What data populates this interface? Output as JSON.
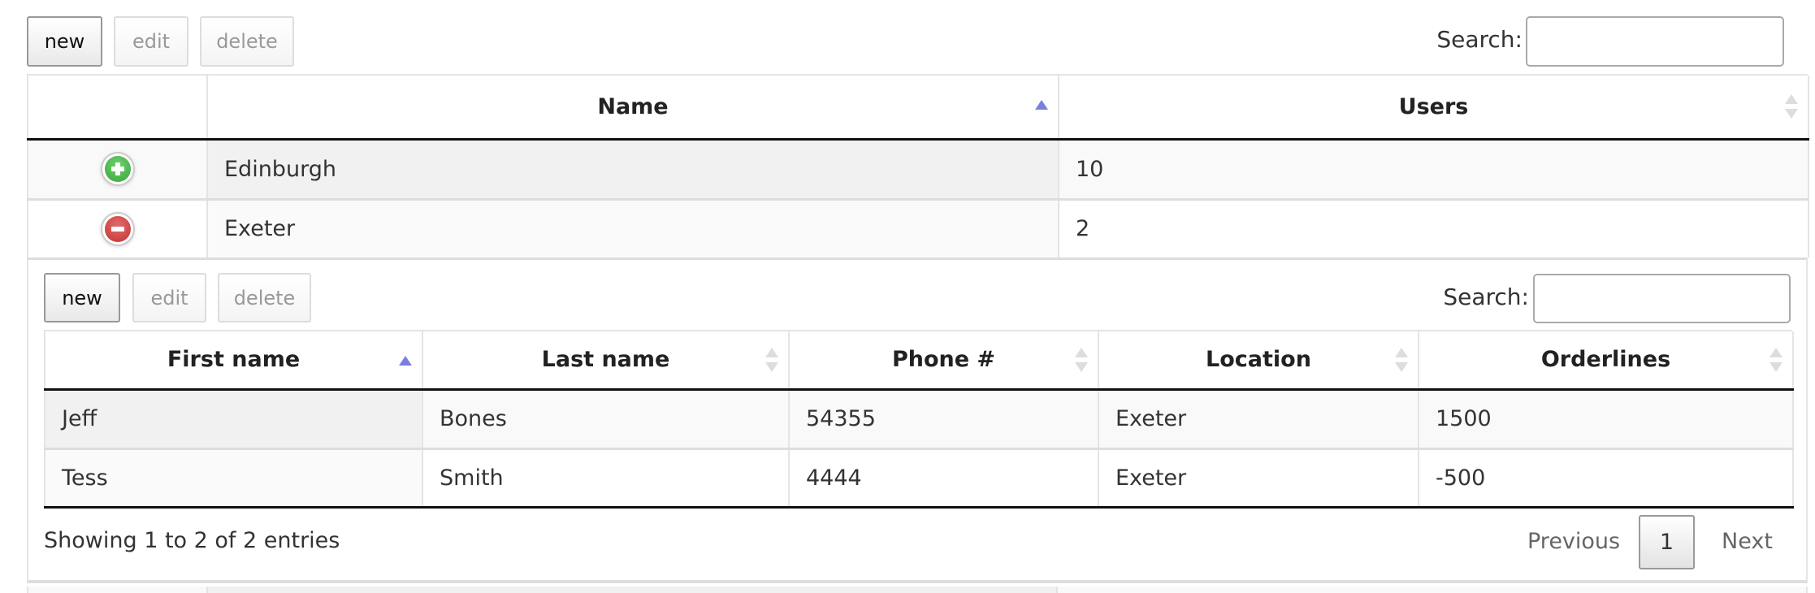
{
  "toolbar": {
    "new_label": "new",
    "edit_label": "edit",
    "delete_label": "delete",
    "search_label": "Search:",
    "search_value": ""
  },
  "locations_table": {
    "columns": [
      {
        "label": "",
        "sort": "none"
      },
      {
        "label": "Name",
        "sort": "asc"
      },
      {
        "label": "Users",
        "sort": "both"
      }
    ],
    "rows": [
      {
        "expand_icon": "plus-circle-icon",
        "name": "Edinburgh",
        "users": "10",
        "expanded": false
      },
      {
        "expand_icon": "minus-circle-icon",
        "name": "Exeter",
        "users": "2",
        "expanded": true
      }
    ]
  },
  "child": {
    "toolbar": {
      "new_label": "new",
      "edit_label": "edit",
      "delete_label": "delete",
      "search_label": "Search:",
      "search_value": ""
    },
    "users_table": {
      "columns": [
        {
          "label": "First name",
          "sort": "asc"
        },
        {
          "label": "Last name",
          "sort": "both"
        },
        {
          "label": "Phone #",
          "sort": "both"
        },
        {
          "label": "Location",
          "sort": "both"
        },
        {
          "label": "Orderlines",
          "sort": "both"
        }
      ],
      "rows": [
        {
          "first_name": "Jeff",
          "last_name": "Bones",
          "phone": "54355",
          "location": "Exeter",
          "orderlines": "1500"
        },
        {
          "first_name": "Tess",
          "last_name": "Smith",
          "phone": "4444",
          "location": "Exeter",
          "orderlines": "-500"
        }
      ]
    },
    "info": "Showing 1 to 2 of 2 entries",
    "pagination": {
      "previous_label": "Previous",
      "current_page": "1",
      "next_label": "Next"
    }
  },
  "colors": {
    "sort_active": "#7b7fdc",
    "sort_inactive": "#dddddd",
    "expand_green": "#3aa63a",
    "collapse_red": "#c23535"
  }
}
